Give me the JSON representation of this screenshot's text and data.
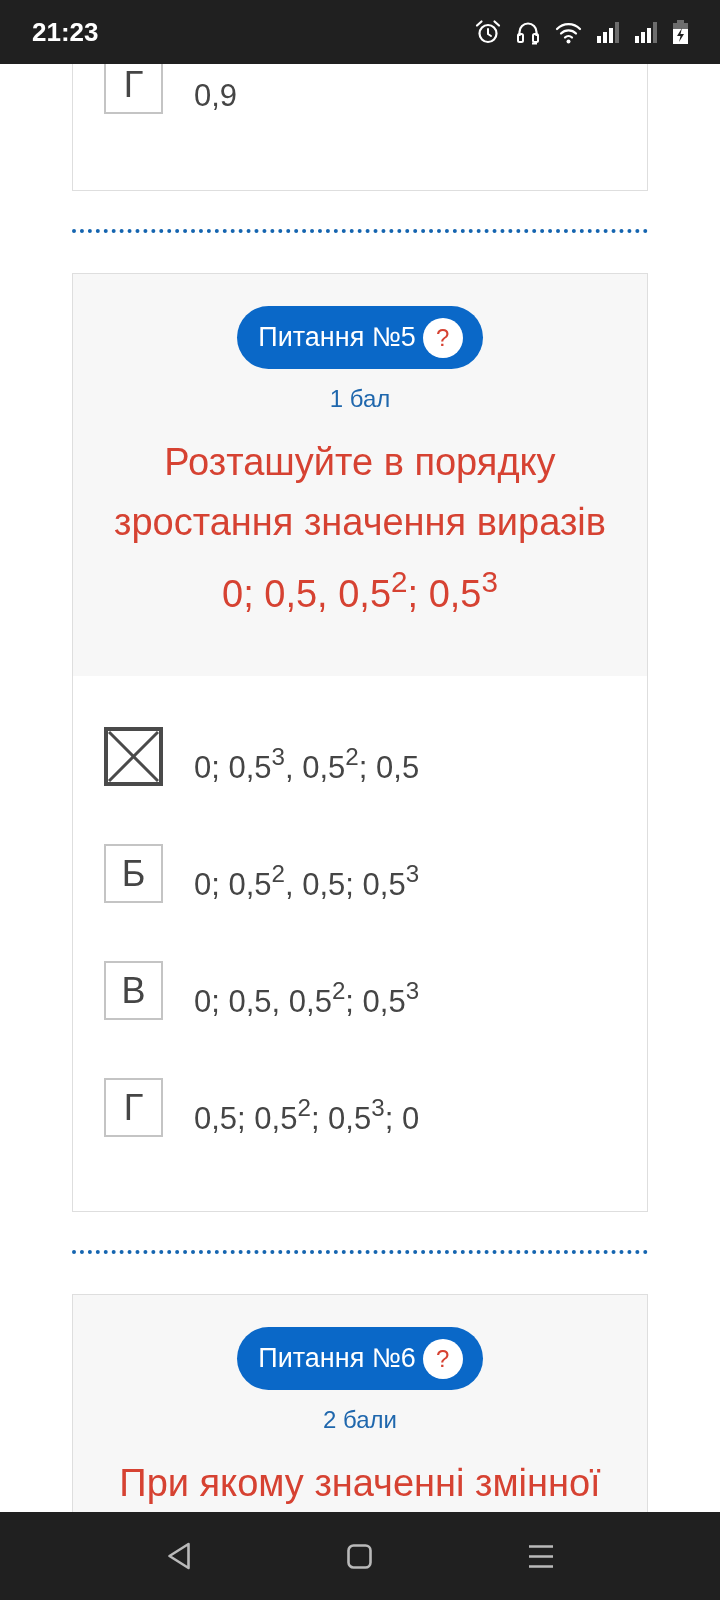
{
  "status_bar": {
    "time": "21:23"
  },
  "questions": [
    {
      "options": [
        {
          "letter": "Г",
          "text": "0,9",
          "selected": false
        }
      ]
    },
    {
      "number_label": "Питання №5",
      "help": "?",
      "points": "1 бал",
      "text": "Розташуйте в порядку зростання значення виразів",
      "expression": "0; 0,5, 0,5$^{2}$; 0,5$^{3}$",
      "options": [
        {
          "text": "0; 0,5$^{3}$, 0,5$^{2}$; 0,5",
          "selected": true
        },
        {
          "letter": "Б",
          "text": "0; 0,5$^{2}$, 0,5; 0,5$^{3}$",
          "selected": false
        },
        {
          "letter": "В",
          "text": "0; 0,5, 0,5$^{2}$; 0,5$^{3}$",
          "selected": false
        },
        {
          "letter": "Г",
          "text": "0,5; 0,5$^{2}$; 0,5$^{3}$; 0",
          "selected": false
        }
      ]
    },
    {
      "number_label": "Питання №6",
      "help": "?",
      "points": "2 бали",
      "text": "При якому значенні змінної"
    }
  ]
}
